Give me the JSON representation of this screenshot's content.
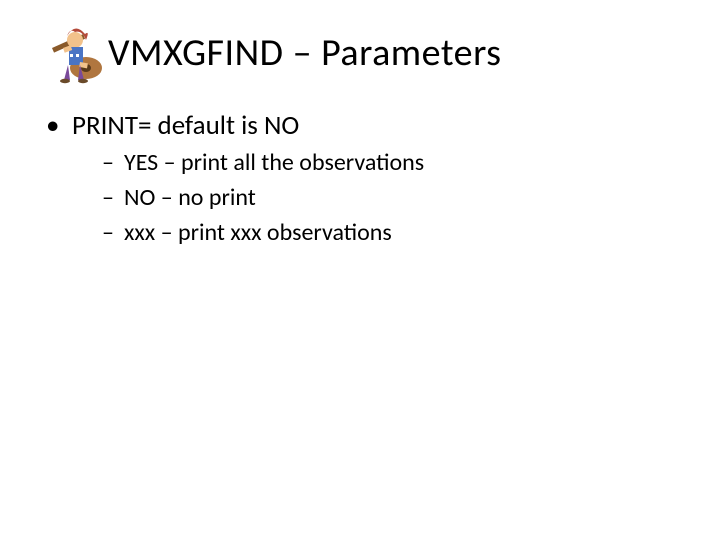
{
  "title": "VMXGFIND – Parameters",
  "clipart_alt": "cartoon-guitar-player-icon",
  "bullets": {
    "level1": [
      "PRINT= default is NO"
    ],
    "level2": [
      "YES – print all the observations",
      "NO – no print",
      "xxx – print xxx observations"
    ]
  }
}
